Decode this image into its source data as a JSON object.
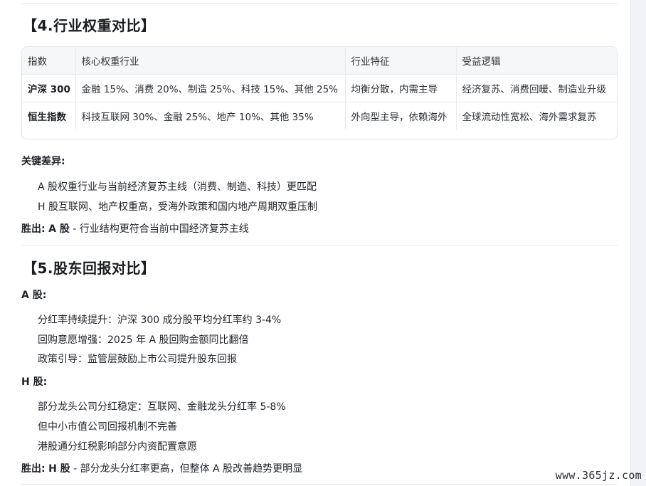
{
  "section4": {
    "title": "【4.行业权重对比】",
    "table": {
      "headers": [
        "指数",
        "核心权重行业",
        "行业特征",
        "受益逻辑"
      ],
      "rows": [
        [
          "沪深 300",
          "金融 15%、消费 20%、制造 25%、科技 15%、其他 25%",
          "均衡分散，内需主导",
          "经济复苏、消费回暖、制造业升级"
        ],
        [
          "恒生指数",
          "科技互联网 30%、金融 25%、地产 10%、其他 35%",
          "外向型主导，依赖海外",
          "全球流动性宽松、海外需求复苏"
        ]
      ]
    },
    "key_label": "关键差异:",
    "points": [
      "A 股权重行业与当前经济复苏主线（消费、制造、科技）更匹配",
      "H 股互联网、地产权重高，受海外政策和国内地产周期双重压制"
    ],
    "winner_label": "胜出:",
    "winner_name": "A 股",
    "winner_reason": " - 行业结构更符合当前中国经济复苏主线"
  },
  "section5": {
    "title": "【5.股东回报对比】",
    "a_label": "A 股:",
    "a_points": [
      "分红率持续提升：沪深 300 成分股平均分红率约 3-4%",
      "回购意愿增强：2025 年 A 股回购金额同比翻倍",
      "政策引导：监管层鼓励上市公司提升股东回报"
    ],
    "h_label": "H 股:",
    "h_points": [
      "部分龙头公司分红稳定：互联网、金融龙头分红率 5-8%",
      "但中小市值公司回报机制不完善",
      "港股通分红税影响部分内资配置意愿"
    ],
    "winner_label": "胜出:",
    "winner_name": "H 股",
    "winner_reason": " - 部分龙头分红率更高，但整体 A 股改善趋势更明显"
  },
  "watermark": "www.365jz.com"
}
